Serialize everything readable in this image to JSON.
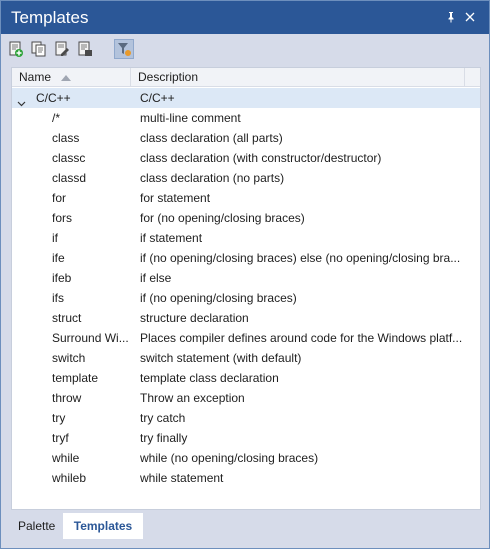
{
  "window": {
    "title": "Templates"
  },
  "titlebar_buttons": {
    "pin_icon": "pin-icon",
    "close_icon": "close-icon"
  },
  "toolbar": {
    "tools": [
      {
        "name": "add-template-icon"
      },
      {
        "name": "copy-template-icon"
      },
      {
        "name": "edit-template-icon"
      },
      {
        "name": "delete-template-icon"
      },
      {
        "name": "filter-icon",
        "active": true
      }
    ]
  },
  "table": {
    "columns": {
      "name": "Name",
      "description": "Description"
    },
    "group": {
      "name": "C/C++",
      "description": "C/C++",
      "expanded": true
    },
    "rows": [
      {
        "name": "/*",
        "description": "multi-line comment"
      },
      {
        "name": "class",
        "description": "class declaration (all parts)"
      },
      {
        "name": "classc",
        "description": "class declaration (with constructor/destructor)"
      },
      {
        "name": "classd",
        "description": "class declaration (no parts)"
      },
      {
        "name": "for",
        "description": "for statement"
      },
      {
        "name": "fors",
        "description": "for (no opening/closing braces)"
      },
      {
        "name": "if",
        "description": "if statement"
      },
      {
        "name": "ife",
        "description": "if (no opening/closing braces) else (no opening/closing bra..."
      },
      {
        "name": "ifeb",
        "description": "if else"
      },
      {
        "name": "ifs",
        "description": "if (no opening/closing braces)"
      },
      {
        "name": "struct",
        "description": "structure declaration"
      },
      {
        "name": "Surround Wi...",
        "description": "Places compiler defines around code for the Windows platf..."
      },
      {
        "name": "switch",
        "description": "switch statement (with default)"
      },
      {
        "name": "template",
        "description": "template class declaration"
      },
      {
        "name": "throw",
        "description": "Throw an exception"
      },
      {
        "name": "try",
        "description": "try catch"
      },
      {
        "name": "tryf",
        "description": "try finally"
      },
      {
        "name": "while",
        "description": "while (no opening/closing braces)"
      },
      {
        "name": "whileb",
        "description": "while statement"
      }
    ]
  },
  "tabs": [
    {
      "label": "Palette",
      "active": false
    },
    {
      "label": "Templates",
      "active": true
    }
  ],
  "colors": {
    "titlebar": "#2b5797",
    "accent": "#2b5797",
    "selected_row": "#dce8f6"
  }
}
